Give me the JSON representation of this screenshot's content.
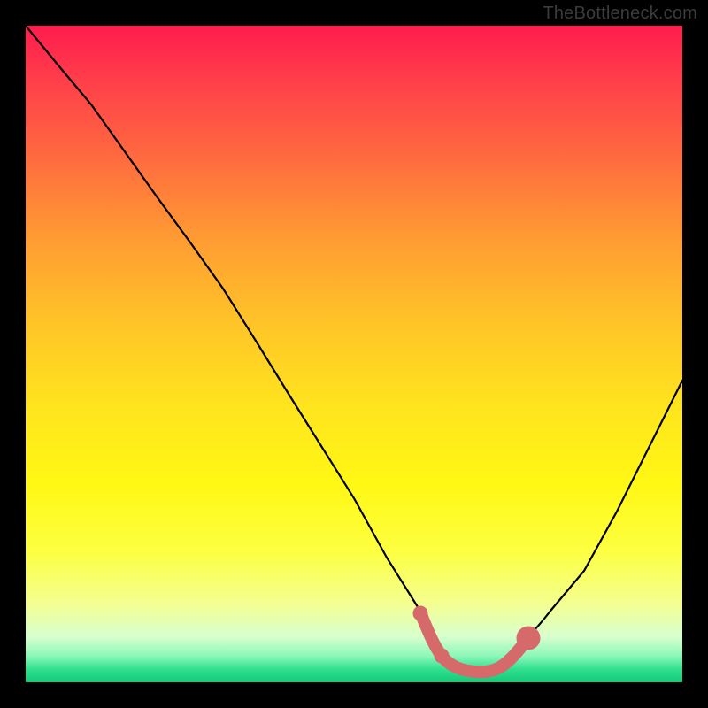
{
  "watermark": "TheBottleneck.com",
  "chart_data": {
    "type": "line",
    "title": "",
    "xlabel": "",
    "ylabel": "",
    "xlim": [
      0,
      100
    ],
    "ylim": [
      0,
      100
    ],
    "series": [
      {
        "name": "bottleneck-curve",
        "color": "#000000",
        "x": [
          0,
          5,
          10,
          15,
          20,
          25,
          30,
          35,
          40,
          45,
          50,
          55,
          60,
          62,
          64,
          66,
          68,
          70,
          72,
          74,
          76,
          80,
          85,
          90,
          95,
          100
        ],
        "y": [
          100,
          94,
          88,
          81,
          74,
          67,
          60,
          52,
          44,
          36,
          28,
          19,
          11,
          8,
          5,
          3,
          2,
          2,
          2,
          3,
          5,
          9,
          17,
          26,
          36,
          46
        ]
      }
    ],
    "highlight_region": {
      "name": "optimum-band",
      "color": "#d66a6a",
      "x_range": [
        60,
        76
      ],
      "y": 2,
      "thickness": 3,
      "endpoints": [
        {
          "x": 60,
          "y": 11,
          "r": 1.2
        },
        {
          "x": 64,
          "y": 5,
          "r": 1.2
        },
        {
          "x": 76,
          "y": 5,
          "r": 2.2
        }
      ]
    },
    "gradient_stops": [
      {
        "pos": 0,
        "color": "#ff1c4d"
      },
      {
        "pos": 50,
        "color": "#ffe41e"
      },
      {
        "pos": 90,
        "color": "#f4ff90"
      },
      {
        "pos": 100,
        "color": "#15c979"
      }
    ]
  }
}
